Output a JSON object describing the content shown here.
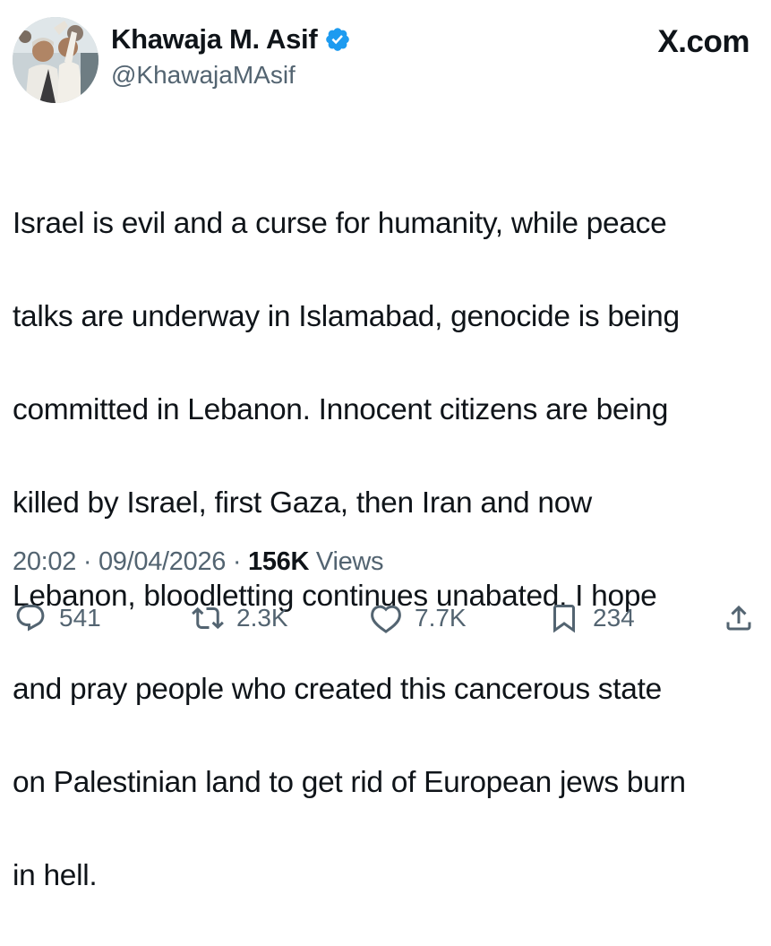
{
  "author": {
    "display_name": "Khawaja M. Asif",
    "handle": "@KhawajaMAsif",
    "verified_icon": "verified-badge-icon",
    "avatar": "profile-photo"
  },
  "site_label": "X.com",
  "tweet": {
    "text": "Israel is evil and a curse for humanity, while peace talks are underway in Islamabad, genocide is being committed in Lebanon. Innocent citizens are being killed by Israel, first Gaza, then Iran and now Lebanon, bloodletting continues unabated. I hope and pray people who created this cancerous state on Palestinian land to get rid of European jews burn in hell.",
    "lines": [
      "Israel is evil and a curse for humanity, while peace",
      "talks are underway in Islamabad, genocide is being",
      "committed in Lebanon. Innocent citizens are being",
      "killed by Israel, first Gaza, then Iran and now",
      "Lebanon, bloodletting continues unabated. I hope",
      "and pray people who created this cancerous state",
      "on Palestinian land to get rid of European jews burn",
      "in hell."
    ]
  },
  "meta": {
    "time": "20:02",
    "separator": "·",
    "date": "09/04/2026",
    "views_count": "156K",
    "views_label": "Views"
  },
  "actions": {
    "replies": {
      "count": "541",
      "icon": "reply-icon"
    },
    "reposts": {
      "count": "2.3K",
      "icon": "repost-icon"
    },
    "likes": {
      "count": "7.7K",
      "icon": "like-icon"
    },
    "bookmarks": {
      "count": "234",
      "icon": "bookmark-icon"
    },
    "share": {
      "icon": "share-icon"
    }
  },
  "colors": {
    "text": "#0f1419",
    "secondary": "#536471",
    "verified_blue": "#1d9bf0",
    "background": "#ffffff"
  }
}
